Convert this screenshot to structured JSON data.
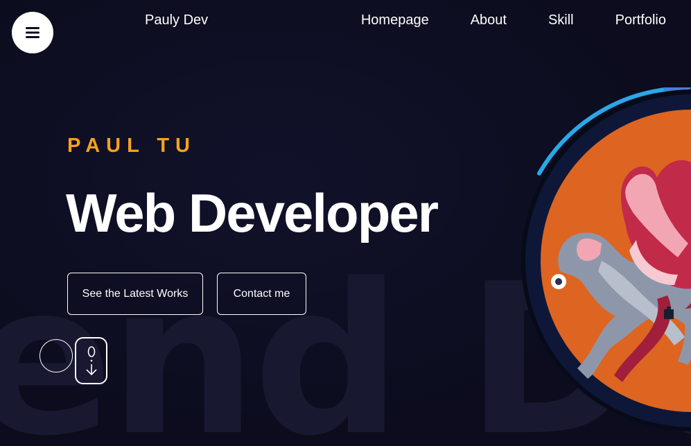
{
  "header": {
    "brand": "Pauly Dev",
    "nav": [
      {
        "label": "Homepage"
      },
      {
        "label": "About"
      },
      {
        "label": "Skill"
      },
      {
        "label": "Portfolio"
      }
    ]
  },
  "hero": {
    "eyebrow": "PAUL TU",
    "headline": "Web Developer",
    "background_text": "end De",
    "buttons": {
      "works": "See the Latest Works",
      "contact": "Contact me"
    }
  },
  "icons": {
    "menu": "hamburger-menu-icon",
    "scroll": "scroll-mouse-icon",
    "avatar": "pixel-octopus-avatar"
  },
  "colors": {
    "background": "#0d0d1f",
    "accent": "#f7a21b",
    "text": "#ffffff",
    "avatar_bg": "#dd6521",
    "ring": "#0f1738",
    "progress_arc": "#29a8e8"
  }
}
